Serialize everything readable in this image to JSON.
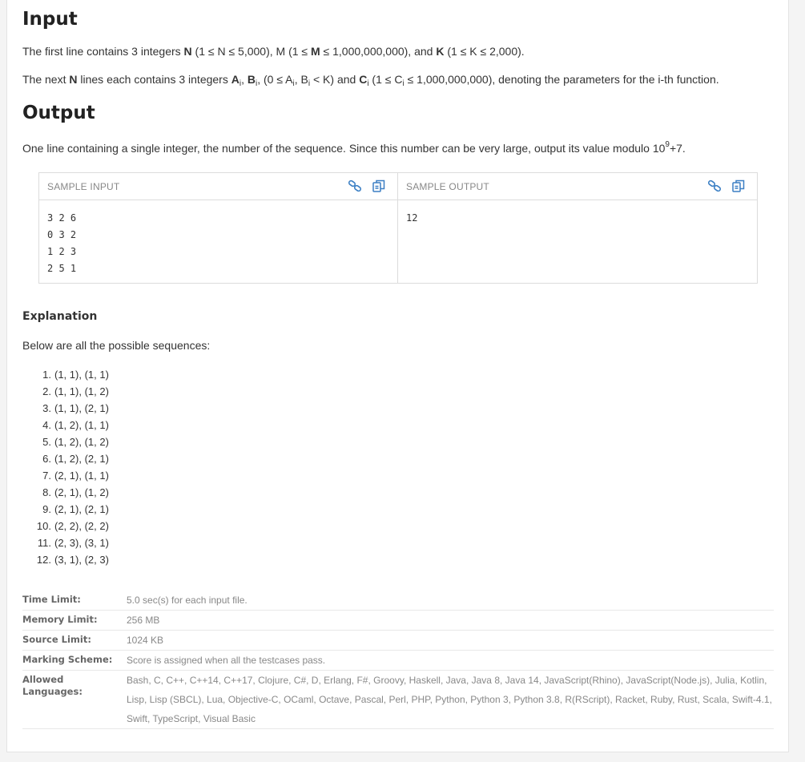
{
  "input_section": {
    "heading": "Input",
    "line1": {
      "t1": "The first line contains 3 integers ",
      "n": "N",
      "t2": " (1 ≤ N ≤ 5,000), M (1 ≤ ",
      "m": "M",
      "t3": " ≤ 1,000,000,000), and ",
      "k": "K",
      "t4": " (1 ≤ K ≤ 2,000)."
    },
    "line2": {
      "t1": "The next ",
      "n": "N",
      "t2": " lines each contains 3 integers ",
      "a": "A",
      "a_sub": "i",
      "comma1": ", ",
      "b": "B",
      "b_sub": "i",
      "t3": ", (0 ≤ A",
      "a2_sub": "i",
      "t4": ", B",
      "b2_sub": "i",
      "t5": " < K) and ",
      "c": "C",
      "c_sub": "i",
      "t6": " (1 ≤ C",
      "c2_sub": "i",
      "t7": " ≤ 1,000,000,000), denoting the parameters for the i-th function."
    }
  },
  "output_section": {
    "heading": "Output",
    "text": "One line containing a single integer, the number of the sequence. Since this number can be very large, output its value modulo 10",
    "sup": "9",
    "tail": "+7."
  },
  "sample": {
    "input_title": "SAMPLE INPUT",
    "output_title": "SAMPLE OUTPUT",
    "input_text": "3 2 6\n0 3 2\n1 2 3\n2 5 1",
    "output_text": "12",
    "icons": [
      "link-icon",
      "copy-icon"
    ],
    "accent_color": "#3b7fc4"
  },
  "explanation": {
    "title": "Explanation",
    "intro": "Below are all the possible sequences:",
    "items": [
      {
        "num": "1.",
        "text": "(1, 1), (1, 1)"
      },
      {
        "num": "2.",
        "text": "(1, 1), (1, 2)"
      },
      {
        "num": "3.",
        "text": "(1, 1), (2, 1)"
      },
      {
        "num": "4.",
        "text": "(1, 2), (1, 1)"
      },
      {
        "num": "5.",
        "text": "(1, 2), (1, 2)"
      },
      {
        "num": "6.",
        "text": "(1, 2), (2, 1)"
      },
      {
        "num": "7.",
        "text": "(2, 1), (1, 1)"
      },
      {
        "num": "8.",
        "text": "(2, 1), (1, 2)"
      },
      {
        "num": "9.",
        "text": "(2, 1), (2, 1)"
      },
      {
        "num": "10.",
        "text": "(2, 2), (2, 2)"
      },
      {
        "num": "11.",
        "text": "(2, 3), (3, 1)"
      },
      {
        "num": "12.",
        "text": "(3, 1), (2, 3)"
      }
    ]
  },
  "limits": [
    {
      "key": "Time Limit:",
      "value": "5.0 sec(s) for each input file."
    },
    {
      "key": "Memory Limit:",
      "value": "256 MB"
    },
    {
      "key": "Source Limit:",
      "value": "1024 KB"
    },
    {
      "key": "Marking Scheme:",
      "value": "Score is assigned when all the testcases pass."
    },
    {
      "key": "Allowed Languages:",
      "value": "Bash, C, C++, C++14, C++17, Clojure, C#, D, Erlang, F#, Groovy, Haskell, Java, Java 8, Java 14, JavaScript(Rhino), JavaScript(Node.js), Julia, Kotlin, Lisp, Lisp (SBCL), Lua, Objective-C, OCaml, Octave, Pascal, Perl, PHP, Python, Python 3, Python 3.8, R(RScript), Racket, Ruby, Rust, Scala, Swift-4.1, Swift, TypeScript, Visual Basic"
    }
  ]
}
